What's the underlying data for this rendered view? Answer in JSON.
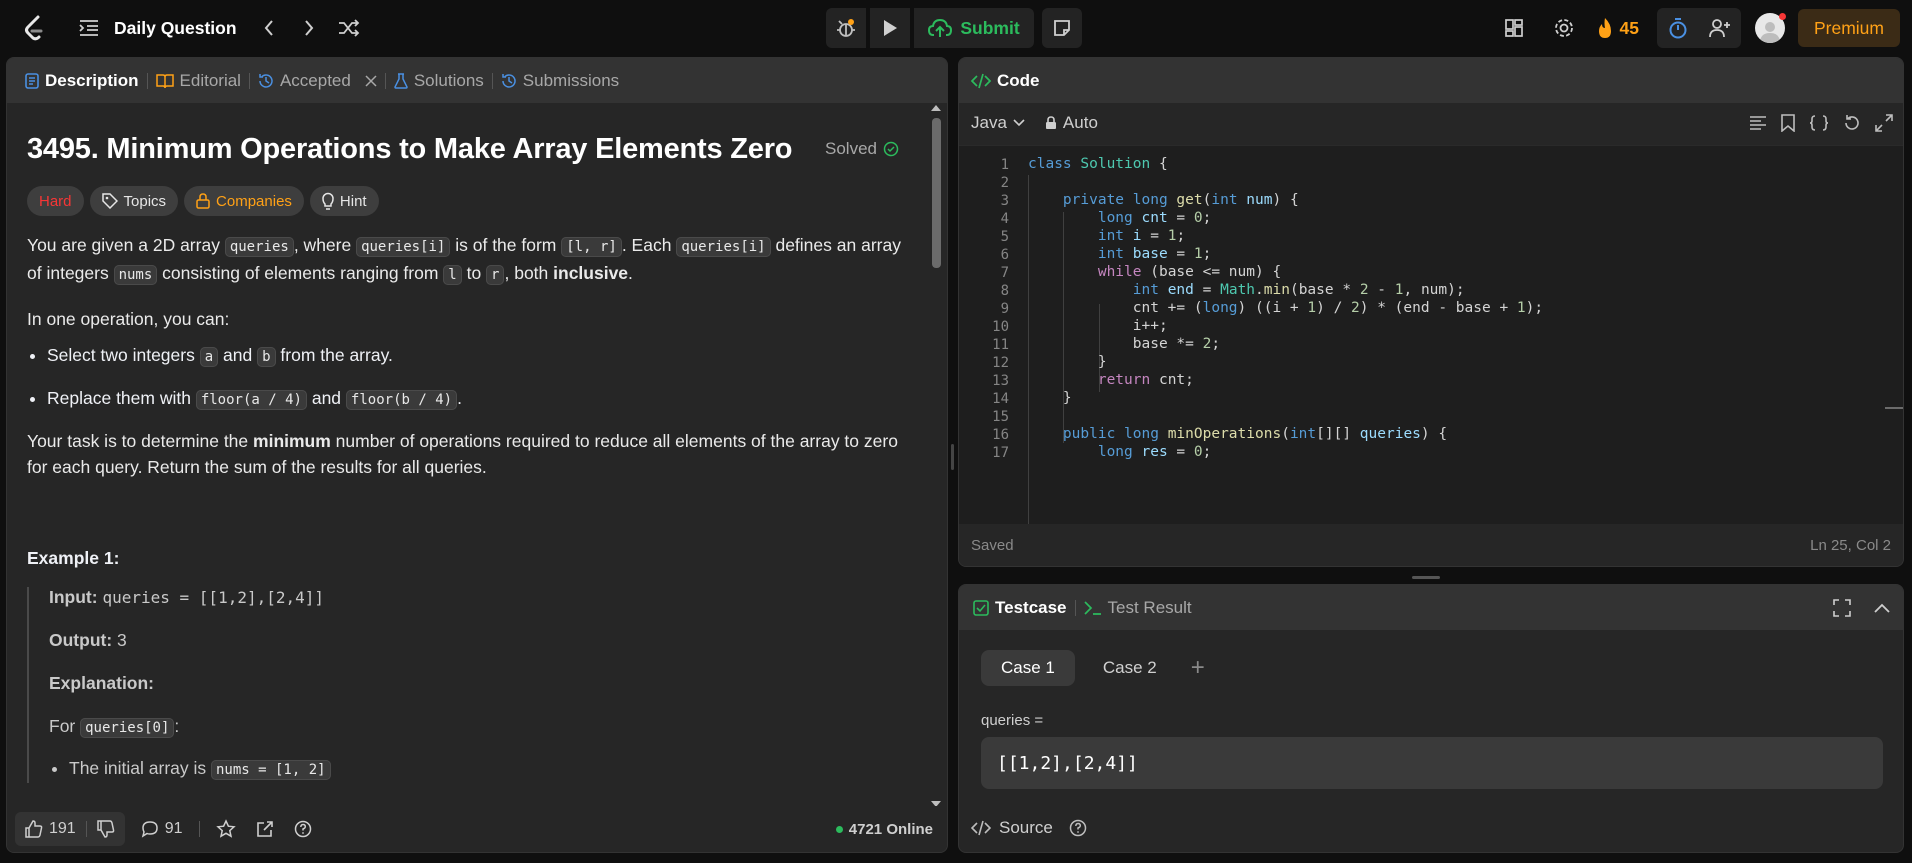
{
  "topbar": {
    "title": "Daily Question",
    "submit_label": "Submit",
    "streak_count": "45",
    "premium_label": "Premium"
  },
  "left_tabs": [
    {
      "label": "Description"
    },
    {
      "label": "Editorial"
    },
    {
      "label": "Accepted"
    },
    {
      "label": "Solutions"
    },
    {
      "label": "Submissions"
    }
  ],
  "problem": {
    "title": "3495. Minimum Operations to Make Array Elements Zero",
    "solved_label": "Solved",
    "difficulty": "Hard",
    "topics_label": "Topics",
    "companies_label": "Companies",
    "hint_label": "Hint",
    "p1_a": "You are given a 2D array ",
    "p1_code1": "queries",
    "p1_b": ", where ",
    "p1_code2": "queries[i]",
    "p1_c": " is of the form ",
    "p1_code3": "[l, r]",
    "p1_d": ". Each ",
    "p1_code4": "queries[i]",
    "p1_e": " defines an array of integers ",
    "p1_code5": "nums",
    "p1_f": " consisting of elements ranging from ",
    "p1_code6": "l",
    "p1_g": " to ",
    "p1_code7": "r",
    "p1_h": ", both ",
    "p1_bold": "inclusive",
    "p1_end": ".",
    "p2": "In one operation, you can:",
    "b1_a": "Select two integers ",
    "b1_code1": "a",
    "b1_b": " and ",
    "b1_code2": "b",
    "b1_c": " from the array.",
    "b2_a": "Replace them with ",
    "b2_code1": "floor(a / 4)",
    "b2_b": " and ",
    "b2_code2": "floor(b / 4)",
    "b2_c": ".",
    "p3_a": "Your task is to determine the ",
    "p3_bold": "minimum",
    "p3_b": " number of operations required to reduce all elements of the array to zero for each query. Return the sum of the results for all queries.",
    "example_title": "Example 1:",
    "input_label": "Input:",
    "input_value": "queries = [[1,2],[2,4]]",
    "output_label": "Output:",
    "output_value": "3",
    "explanation_label": "Explanation:",
    "for_text": "For ",
    "for_code": "queries[0]",
    "for_colon": ":",
    "partial_bullet": "The initial array is ",
    "partial_code": "nums = [1, 2]"
  },
  "left_footer": {
    "likes": "191",
    "comments": "91",
    "online": "4721 Online"
  },
  "code_panel": {
    "title": "Code",
    "language": "Java",
    "auto_label": "Auto",
    "saved_label": "Saved",
    "cursor_pos": "Ln 25, Col 2",
    "line_numbers": [
      "1",
      "2",
      "3",
      "4",
      "5",
      "6",
      "7",
      "8",
      "9",
      "10",
      "11",
      "12",
      "13",
      "14",
      "15",
      "16",
      "17"
    ]
  },
  "test_panel": {
    "testcase_label": "Testcase",
    "result_label": "Test Result",
    "case1": "Case 1",
    "case2": "Case 2",
    "add_symbol": "+",
    "param_label": "queries =",
    "param_value": "[[1,2],[2,4]]",
    "source_label": "Source"
  },
  "colors": {
    "accent_orange": "#ffa116",
    "submit_green": "#2cbb5d",
    "hard_red": "#f63636",
    "link_blue": "#4a90e2"
  }
}
